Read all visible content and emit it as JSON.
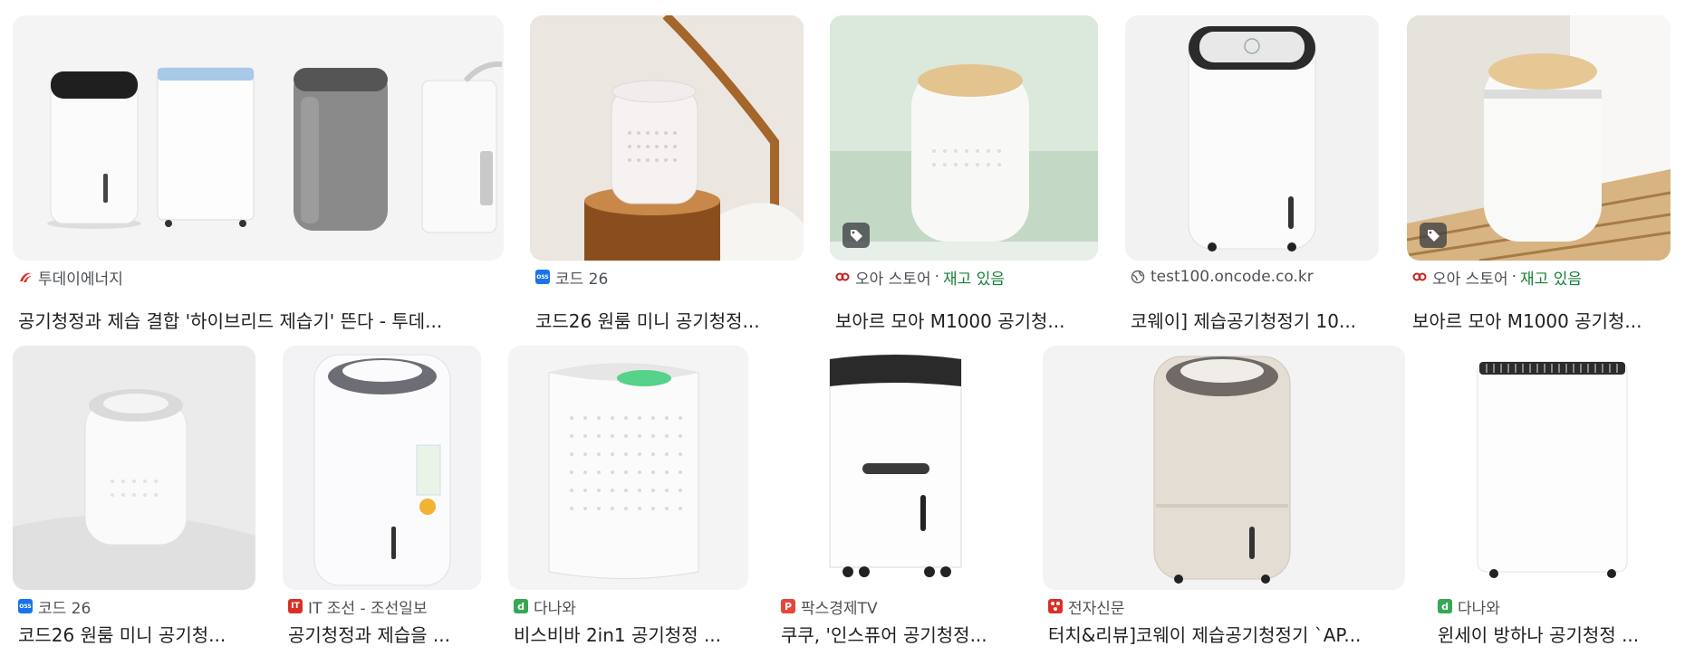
{
  "results": [
    {
      "source": "투데이에너지",
      "title": "공기청정과 제습 결합 '하이브리드 제습기' 뜬다 - 투데...",
      "favicon": "swoosh-icon",
      "favicon_color": "#d93025"
    },
    {
      "source": "코드 26",
      "title": "코드26 원룸 미니 공기청정...",
      "favicon": "code26-icon",
      "favicon_color": "#1a73e8",
      "favicon_text": "OSS"
    },
    {
      "source": "오아 스토어",
      "stock": "재고 있음",
      "title": "보아르 모아 M1000 공기청...",
      "favicon": "oa-icon",
      "favicon_color": "#c5221f",
      "has_tag": true
    },
    {
      "source": "test100.oncode.co.kr",
      "title": "코웨이] 제습공기청정기 10...",
      "favicon": "globe-icon",
      "favicon_color": "#5f6368"
    },
    {
      "source": "오아 스토어",
      "stock": "재고 있음",
      "title": "보아르 모아 M1000 공기청...",
      "favicon": "oa-icon",
      "favicon_color": "#c5221f",
      "has_tag": true
    },
    {
      "source": "코드 26",
      "title": "코드26 원룸 미니 공기청...",
      "favicon": "code26-icon",
      "favicon_color": "#1a73e8",
      "favicon_text": "OSS"
    },
    {
      "source": "IT 조선 - 조선일보",
      "title": "공기청정과 제습을 ...",
      "favicon": "it-icon",
      "favicon_color": "#d93025",
      "favicon_text": "IT"
    },
    {
      "source": "다나와",
      "title": "비스비바 2in1 공기청정 ...",
      "favicon": "danawa-icon",
      "favicon_color": "#34a853",
      "favicon_text": "d"
    },
    {
      "source": "팍스경제TV",
      "title": "쿠쿠, '인스퓨어 공기청정...",
      "favicon": "paxtv-icon",
      "favicon_color": "#e8453c",
      "favicon_text": "P"
    },
    {
      "source": "전자신문",
      "title": "터치&리뷰]코웨이 제습공기청정기 `AP...",
      "favicon": "etnews-icon",
      "favicon_color": "#d93025"
    },
    {
      "source": "다나와",
      "title": "윈세이 방하나 공기청정 ...",
      "favicon": "danawa-icon",
      "favicon_color": "#34a853",
      "favicon_text": "d"
    }
  ]
}
